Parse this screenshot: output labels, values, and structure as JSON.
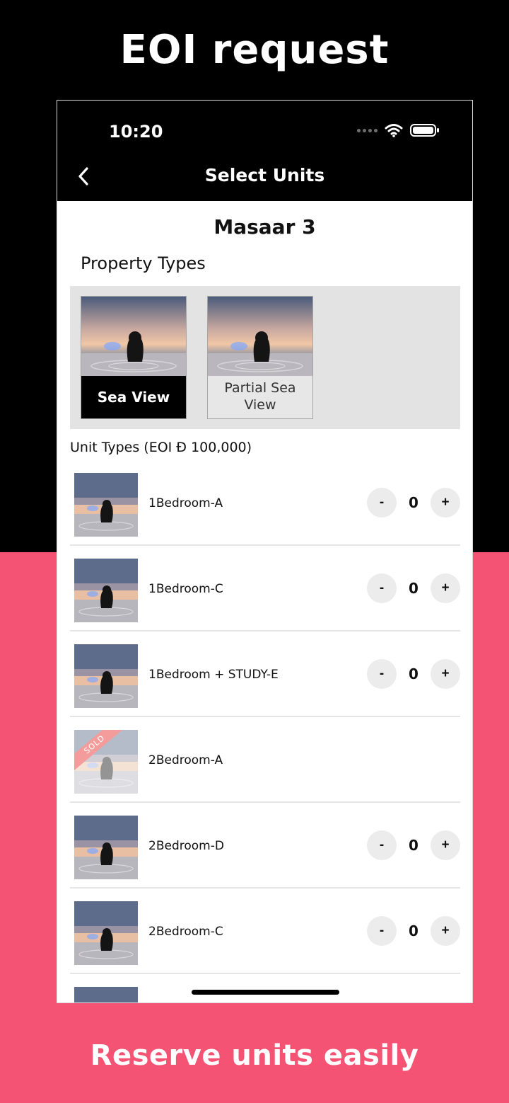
{
  "promo": {
    "title": "EOI request",
    "caption": "Reserve units easily"
  },
  "status_bar": {
    "time": "10:20"
  },
  "nav": {
    "title": "Select Units"
  },
  "project": {
    "title": "Masaar 3"
  },
  "property_types": {
    "label": "Property Types",
    "items": [
      {
        "label": "Sea View",
        "selected": true
      },
      {
        "label": "Partial Sea View",
        "selected": false
      }
    ]
  },
  "unit_types": {
    "label": "Unit Types (EOI Đ 100,000)",
    "items": [
      {
        "name": "1Bedroom-A",
        "count": "0",
        "sold": false
      },
      {
        "name": "1Bedroom-C",
        "count": "0",
        "sold": false
      },
      {
        "name": "1Bedroom + STUDY-E",
        "count": "0",
        "sold": false
      },
      {
        "name": "2Bedroom-A",
        "count": "",
        "sold": true,
        "sold_label": "SOLD"
      },
      {
        "name": "2Bedroom-D",
        "count": "0",
        "sold": false
      },
      {
        "name": "2Bedroom-C",
        "count": "0",
        "sold": false
      }
    ],
    "minus_label": "-",
    "plus_label": "+"
  },
  "colors": {
    "accent": "#f55374",
    "header": "#000000",
    "panel": "#e3e3e3"
  }
}
